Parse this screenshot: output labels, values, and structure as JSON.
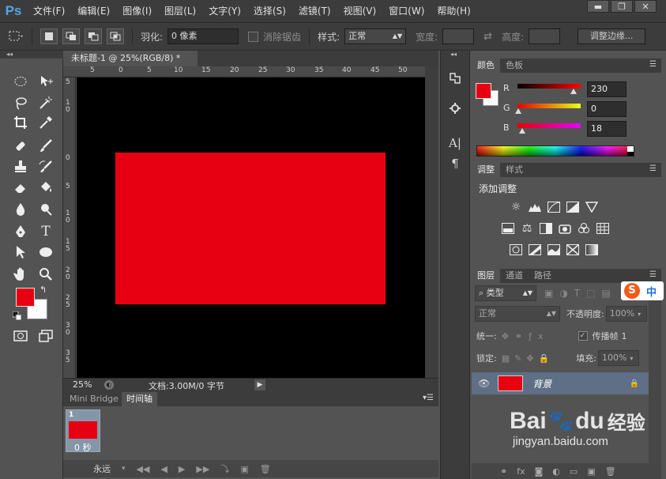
{
  "app": {
    "logo": "Ps",
    "accent": "#4ea6ea"
  },
  "menu": [
    "文件(F)",
    "编辑(E)",
    "图像(I)",
    "图层(L)",
    "文字(Y)",
    "选择(S)",
    "滤镜(T)",
    "视图(V)",
    "窗口(W)",
    "帮助(H)"
  ],
  "window_buttons": {
    "minimize": "▬",
    "restore": "❐",
    "close": "✕"
  },
  "options_bar": {
    "feather_label": "羽化:",
    "feather_value": "0 像素",
    "antialias_label": "消除锯齿",
    "style_label": "样式:",
    "style_value": "正常",
    "width_label": "宽度:",
    "height_label": "高度:",
    "refine_edge": "调整边缘..."
  },
  "document": {
    "tab_title": "未标题-1 @ 25%(RGB/8) *",
    "close": "×",
    "ruler_top": [
      "5",
      "0",
      "5",
      "10",
      "15",
      "20",
      "25",
      "30",
      "35",
      "40",
      "45",
      "50"
    ],
    "ruler_left": [
      "5",
      "1\n0",
      "0",
      "5",
      "1\n0",
      "1\n5",
      "2\n0",
      "2\n5",
      "3\n0",
      "3\n5"
    ],
    "canvas_color": "#000000",
    "rect_color": "#e60012"
  },
  "status": {
    "zoom": "25%",
    "doc_info": "文档:3.00M/0 字节"
  },
  "timeline": {
    "tabs": [
      "Mini Bridge",
      "时间轴"
    ],
    "frame_number": "1",
    "frame_delay": "0 秒",
    "loop": "永远"
  },
  "color_panel": {
    "tabs": [
      "颜色",
      "色板"
    ],
    "r_label": "R",
    "g_label": "G",
    "b_label": "B",
    "r_value": "230",
    "g_value": "0",
    "b_value": "18",
    "foreground": "#e60012",
    "background": "#ffffff"
  },
  "adjust_panel": {
    "tabs": [
      "调整",
      "样式"
    ],
    "add_label": "添加调整"
  },
  "layers_panel": {
    "tabs": [
      "图层",
      "通道",
      "路径"
    ],
    "filter_kind": "类型",
    "blend_mode": "正常",
    "opacity_label": "不透明度:",
    "opacity_value": "100%",
    "unify_label": "统一:",
    "propagate_label": "传播帧",
    "propagate_value": "1",
    "lock_label": "锁定:",
    "fill_label": "填充:",
    "fill_value": "100%",
    "layer_name": "背景",
    "layer_color": "#e60012"
  },
  "watermark": {
    "brand": "Bai",
    "paw": "du",
    "cn": "经验",
    "url": "jingyan.baidu.com"
  },
  "ime": {
    "mode": "中"
  }
}
